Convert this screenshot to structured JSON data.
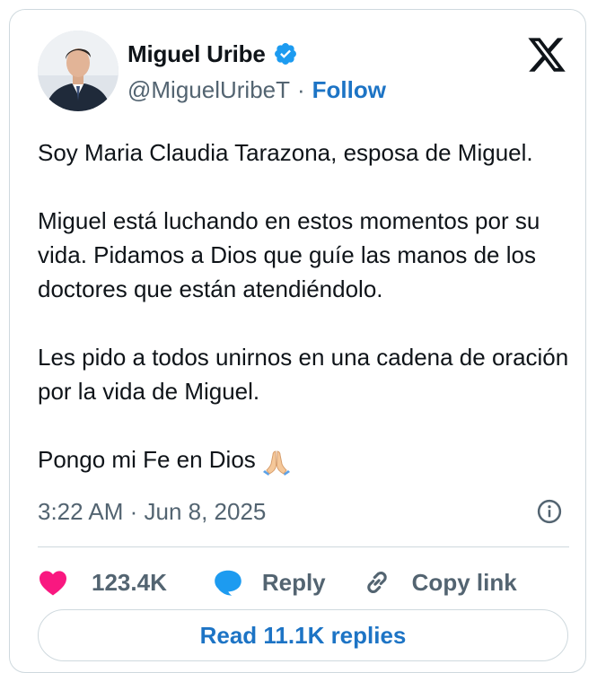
{
  "author": {
    "name": "Miguel Uribe",
    "handle": "@MiguelUribeT",
    "separator": "·",
    "follow_label": "Follow",
    "verified_color": "#1d9bf0"
  },
  "tweet": {
    "paragraphs": [
      "Soy Maria Claudia Tarazona, esposa de Miguel.",
      "Miguel está luchando en estos momentos por su vida. Pidamos a Dios que guíe las manos de los doctores que están atendiéndolo.",
      "Les pido a todos unirnos en una cadena de oración por la vida de Miguel.",
      "Pongo mi Fe en Dios"
    ],
    "emoji": "folded-hands",
    "timestamp": "3:22 AM · Jun 8, 2025"
  },
  "actions": {
    "likes": "123.4K",
    "reply_label": "Reply",
    "copy_label": "Copy link",
    "read_replies_label": "Read 11.1K replies"
  },
  "colors": {
    "accent": "#1d74c5",
    "heart": "#f91880",
    "reply_bubble": "#1d9bf0",
    "muted": "#536471"
  }
}
